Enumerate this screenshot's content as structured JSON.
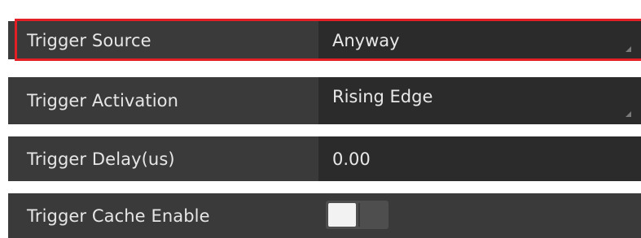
{
  "properties": [
    {
      "label": "Trigger Source",
      "value": "Anyway",
      "control": "dropdown"
    },
    {
      "label": "Trigger Activation",
      "value": "Rising Edge",
      "control": "dropdown"
    },
    {
      "label": "Trigger Delay(us)",
      "value": "0.00",
      "control": "text"
    },
    {
      "label": "Trigger Cache Enable",
      "control": "toggle",
      "enabled": false
    }
  ],
  "colors": {
    "highlight": "#e41f25",
    "row_background": "#3a3a3a",
    "value_background": "#2b2b2b",
    "text": "#e6e6e6"
  },
  "icons": {
    "dropdown_indicator": "dropdown-corner-icon"
  }
}
